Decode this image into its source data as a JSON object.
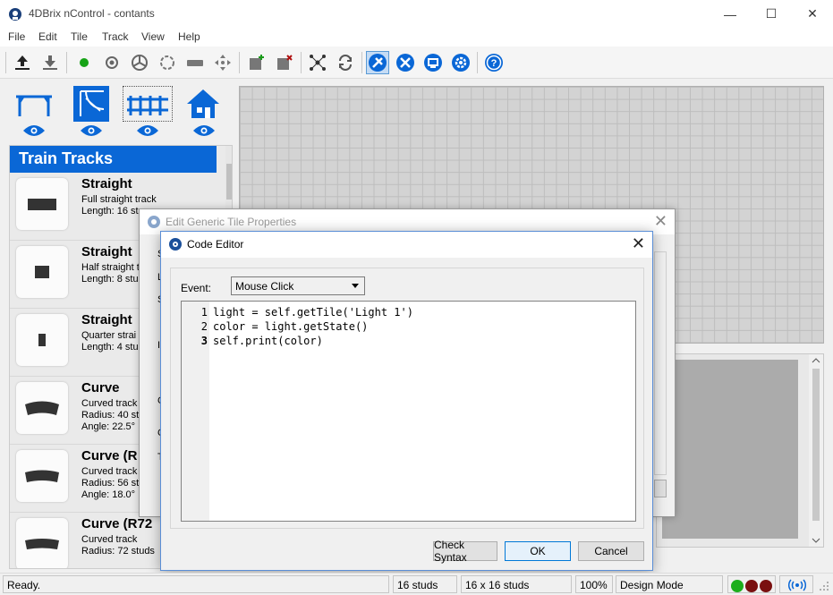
{
  "window": {
    "title": "4DBrix nControl - contants",
    "minimize": "—",
    "maximize": "☐",
    "close": "✕"
  },
  "menu": [
    "File",
    "Edit",
    "Tile",
    "Track",
    "View",
    "Help"
  ],
  "palette": {
    "header": "Train Tracks",
    "items": [
      {
        "name": "Straight",
        "line1": "Full straight track",
        "line2": "Length: 16 st",
        "line3": ""
      },
      {
        "name": "Straight",
        "line1": "Half straight t",
        "line2": "Length: 8 stu",
        "line3": ""
      },
      {
        "name": "Straight",
        "line1": "Quarter strai",
        "line2": "Length: 4 stu",
        "line3": ""
      },
      {
        "name": "Curve",
        "line1": "Curved track",
        "line2": "Radius: 40 st",
        "line3": "Angle: 22.5°"
      },
      {
        "name": "Curve (R",
        "line1": "Curved track",
        "line2": "Radius: 56 st",
        "line3": "Angle: 18.0°"
      },
      {
        "name": "Curve (R72",
        "line1": "Curved track",
        "line2": "Radius: 72 studs",
        "line3": ""
      }
    ]
  },
  "back_dialog": {
    "title": "Edit Generic Tile Properties",
    "close": "✕",
    "letters": [
      "S",
      "L",
      "S",
      "I",
      "C",
      "C",
      "T"
    ]
  },
  "code_editor": {
    "title": "Code Editor",
    "close": "✕",
    "event_label": "Event:",
    "event_value": "Mouse Click",
    "lines": [
      {
        "n": "1",
        "code": "light = self.getTile('Light 1')"
      },
      {
        "n": "2",
        "code": "color = light.getState()"
      },
      {
        "n": "3",
        "code": "self.print(color)"
      }
    ],
    "buttons": {
      "check": "Check Syntax",
      "ok": "OK",
      "cancel": "Cancel"
    }
  },
  "status": {
    "ready": "Ready.",
    "studs": "16 studs",
    "size": "16 x 16 studs",
    "zoom": "100%",
    "mode": "Design Mode"
  },
  "colors": {
    "accent": "#0a67d6",
    "light_green": "#1cae1c",
    "light_red_dark": "#7a1010"
  }
}
